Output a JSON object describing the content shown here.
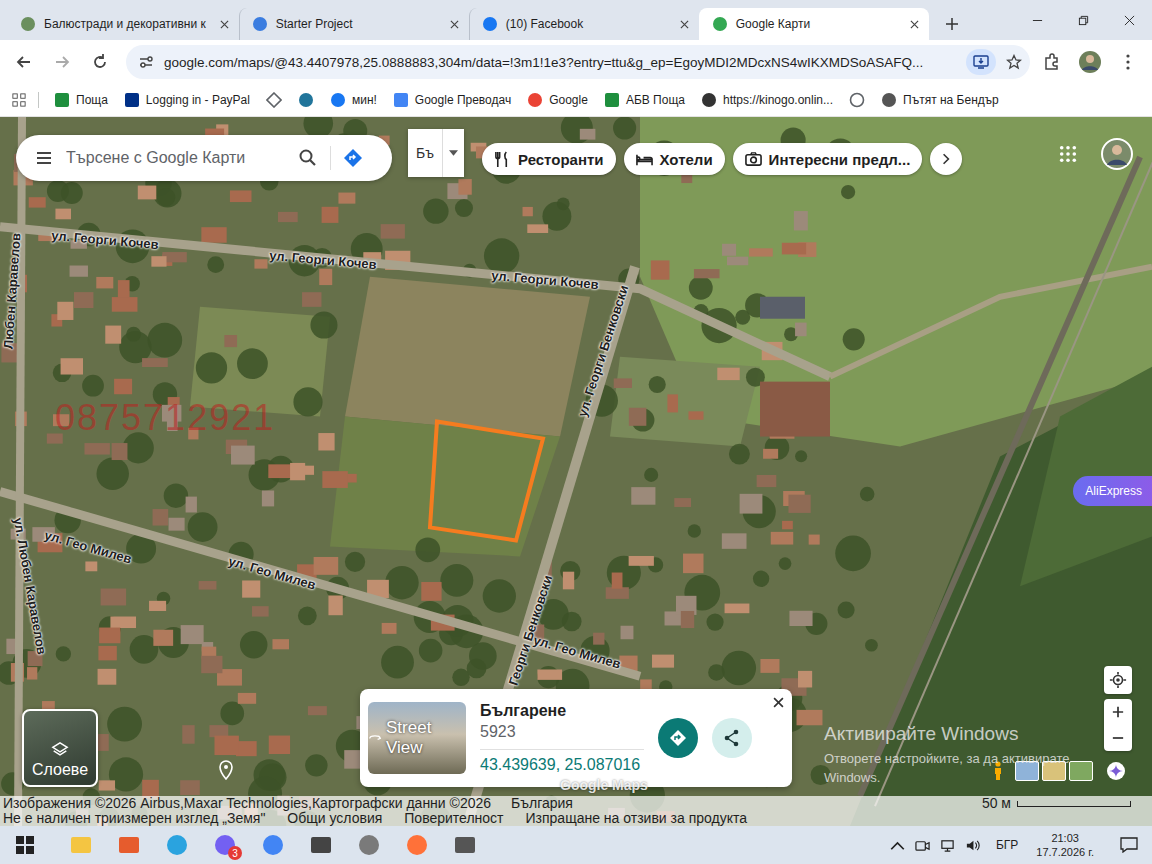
{
  "browser": {
    "tabs": [
      {
        "label": "Балюстради и декоративни к",
        "kind": "site",
        "selected": false
      },
      {
        "label": "Starter Project",
        "kind": "starter",
        "selected": false
      },
      {
        "label": "(10) Facebook",
        "kind": "facebook",
        "selected": false
      },
      {
        "label": "Google Карти",
        "kind": "maps",
        "selected": true
      }
    ],
    "url": "google.com/maps/@43.4407978,25.0888883,304m/data=!3m1!1e3?entry=ttu&g_ep=EgoyMDI2MDcxNS4wIKXMDSoASAFQ...",
    "bookmarks": [
      {
        "label": "Поща",
        "kind": "abv"
      },
      {
        "label": "Logging in - PayPal",
        "kind": "paypal"
      },
      {
        "kind": "diamond"
      },
      {
        "kind": "wordpress"
      },
      {
        "label": "мин!",
        "kind": "facebook"
      },
      {
        "label": "Google Преводач",
        "kind": "translate"
      },
      {
        "label": "Google",
        "kind": "google"
      },
      {
        "label": "АБВ Поща",
        "kind": "abv"
      },
      {
        "label": "https://kinogo.onlin...",
        "kind": "kinogo"
      },
      {
        "kind": "globe"
      },
      {
        "label": "Пътят на Бендър",
        "kind": "bender"
      }
    ]
  },
  "map": {
    "search_placeholder": "Търсене с Google Карти",
    "language": "Бъ",
    "chips": [
      {
        "label": "Ресторанти",
        "kind": "restaurant"
      },
      {
        "label": "Хотели",
        "kind": "hotel"
      },
      {
        "label": "Интересни предл...",
        "kind": "camera"
      }
    ],
    "streets": [
      {
        "label": "ул. Георги Кочев"
      },
      {
        "label": "ул. Георги Кочев"
      },
      {
        "label": "ул. Георги Кочев"
      },
      {
        "label": "ул. Георги Бенковски"
      },
      {
        "label": "ул. Георги Бенковски"
      },
      {
        "label": "ул. Гео Милев"
      },
      {
        "label": "ул. Гео Милев"
      },
      {
        "label": "ул. Гео Милев"
      },
      {
        "label": "Любен Каравелов"
      },
      {
        "label": "ул. Любен Каравелов"
      }
    ],
    "phone_watermark": "0875712921",
    "info_card": {
      "thumbnail_label": "Street View",
      "place": "Българене",
      "postcode": "5923",
      "coordinates": "43.439639, 25.087016"
    },
    "layers_label": "Слоеве",
    "logo": "Google Maps",
    "attribution": "Изображения ©2026 Airbus,Maxar Technologies,Картографски данни ©2026",
    "country": "България",
    "scale": "50 м",
    "footer_links": [
      "Не е наличен триизмерен изглед „Земя\"",
      "Общи условия",
      "Поверителност",
      "Изпращане на отзиви за продукта"
    ]
  },
  "overlays": {
    "aliexpress": "AliExpress",
    "activation_title": "Активирайте Windows",
    "activation_lines": [
      "Отворете настройките, за да активирате",
      "Windows."
    ]
  },
  "taskbar": {
    "apps": [
      {
        "kind": "explorer"
      },
      {
        "kind": "media"
      },
      {
        "kind": "telegram"
      },
      {
        "kind": "viber",
        "badge": "3"
      },
      {
        "kind": "chrome"
      },
      {
        "kind": "video"
      },
      {
        "kind": "reel"
      },
      {
        "kind": "firefox"
      },
      {
        "kind": "calculator"
      }
    ],
    "language": "БГР",
    "time": "21:03",
    "date": "17.7.2026 г."
  }
}
